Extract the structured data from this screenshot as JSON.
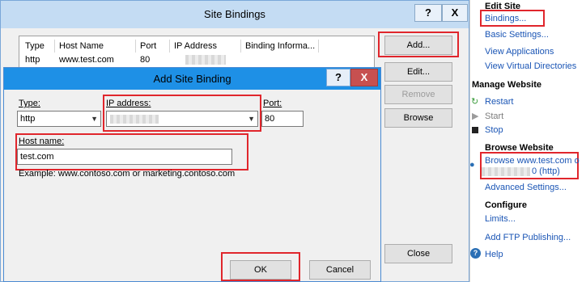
{
  "site_bindings": {
    "title": "Site Bindings",
    "help_label": "?",
    "close_label": "X",
    "columns": [
      "Type",
      "Host Name",
      "Port",
      "IP Address",
      "Binding Informa..."
    ],
    "rows": [
      {
        "type": "http",
        "host": "www.test.com",
        "port": "80",
        "ip": ""
      }
    ],
    "buttons": {
      "add": "Add...",
      "edit": "Edit...",
      "remove": "Remove",
      "browse": "Browse",
      "close": "Close"
    }
  },
  "add_site_binding": {
    "title": "Add Site Binding",
    "help_label": "?",
    "close_label": "X",
    "type_label": "Type:",
    "type_value": "http",
    "ip_label": "IP address:",
    "ip_value": "",
    "port_label": "Port:",
    "port_value": "80",
    "host_label": "Host name:",
    "host_value": "test.com",
    "example": "Example: www.contoso.com or marketing.contoso.com",
    "ok_label": "OK",
    "cancel_label": "Cancel"
  },
  "actions": {
    "edit_site": "Edit Site",
    "bindings": "Bindings...",
    "basic_settings": "Basic Settings...",
    "view_applications": "View Applications",
    "view_virtual_dirs": "View Virtual Directories",
    "manage_website": "Manage Website",
    "restart": "Restart",
    "start": "Start",
    "stop": "Stop",
    "browse_website": "Browse Website",
    "browse_link_line1": "Browse www.test.com o",
    "browse_link_line2": "0 (http)",
    "advanced_settings": "Advanced Settings...",
    "configure": "Configure",
    "limits": "Limits...",
    "add_ftp": "Add FTP Publishing...",
    "help": "Help"
  },
  "accent": {
    "red_highlight": "#e0262c",
    "link": "#1a55b5",
    "active_title": "#1e90e6"
  }
}
